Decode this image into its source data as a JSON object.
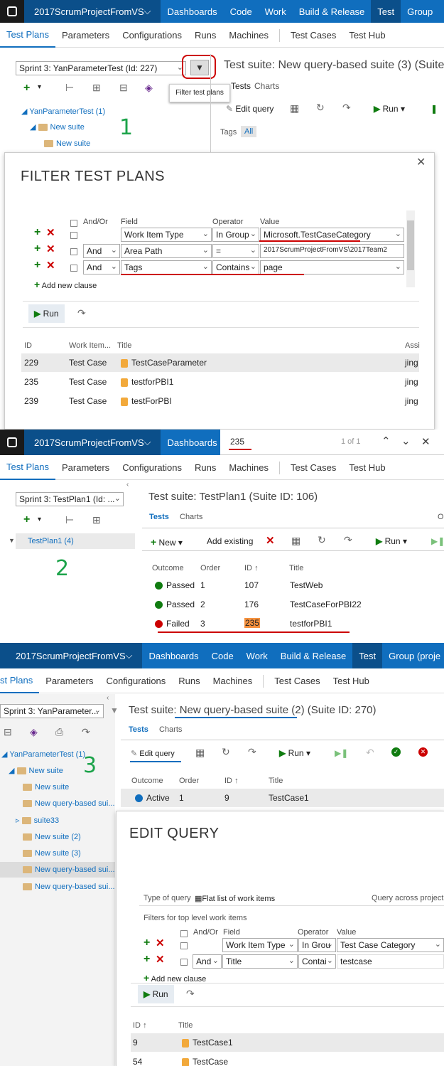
{
  "panel1": {
    "project": "2017ScrumProjectFromVS",
    "nav": [
      "Dashboards",
      "Code",
      "Work",
      "Build & Release",
      "Test",
      "Group"
    ],
    "subnav": [
      "Test Plans",
      "Parameters",
      "Configurations",
      "Runs",
      "Machines",
      "Test Cases",
      "Test Hub"
    ],
    "plan_select": "Sprint 3: YanParameterTest (Id: 227)",
    "suite_title": "Test suite: New query-based suite (3) (Suite I",
    "tooltip": "Filter test plans",
    "tabs": [
      "Tests",
      "Charts"
    ],
    "edit_query": "Edit query",
    "run": "Run",
    "tags_label": "Tags",
    "tags_all": "All",
    "tree": [
      "YanParameterTest (1)",
      "New suite",
      "New suite"
    ],
    "number": "1",
    "dialog_title": "FILTER TEST PLANS",
    "headers": {
      "andor": "And/Or",
      "field": "Field",
      "operator": "Operator",
      "value": "Value"
    },
    "clauses": [
      {
        "andor": "",
        "field": "Work Item Type",
        "op": "In Group",
        "value": "Microsoft.TestCaseCategory"
      },
      {
        "andor": "And",
        "field": "Area Path",
        "op": "=",
        "value": "2017ScrumProjectFromVS\\2017Team2"
      },
      {
        "andor": "And",
        "field": "Tags",
        "op": "Contains",
        "value": "page"
      }
    ],
    "add_clause": "Add new clause",
    "run_btn": "Run",
    "result_headers": {
      "id": "ID",
      "type": "Work Item...",
      "title": "Title",
      "assigned": "Assi"
    },
    "results": [
      {
        "id": "229",
        "type": "Test Case",
        "title": "TestCaseParameter",
        "assigned": "jing"
      },
      {
        "id": "235",
        "type": "Test Case",
        "title": "testforPBI1",
        "assigned": "jing"
      },
      {
        "id": "239",
        "type": "Test Case",
        "title": "testForPBI",
        "assigned": "jing"
      }
    ]
  },
  "panel2": {
    "project": "2017ScrumProjectFromVS",
    "nav_dashboards": "Dashboards",
    "find_value": "235",
    "find_count": "1 of 1",
    "subnav": [
      "Test Plans",
      "Parameters",
      "Configurations",
      "Runs",
      "Machines",
      "Test Cases",
      "Test Hub"
    ],
    "plan_select": "Sprint 3: TestPlan1 (Id: ...",
    "suite_title": "Test suite: TestPlan1 (Suite ID: 106)",
    "tabs": [
      "Tests",
      "Charts"
    ],
    "tab_cut": "O",
    "new": "New",
    "add_existing": "Add existing",
    "run": "Run",
    "tree_item": "TestPlan1 (4)",
    "number": "2",
    "headers": {
      "outcome": "Outcome",
      "order": "Order",
      "id": "ID",
      "title": "Title"
    },
    "rows": [
      {
        "outcome": "Passed",
        "order": "1",
        "id": "107",
        "title": "TestWeb"
      },
      {
        "outcome": "Passed",
        "order": "2",
        "id": "176",
        "title": "TestCaseForPBI22"
      },
      {
        "outcome": "Failed",
        "order": "3",
        "id": "235",
        "title": "testforPBI1"
      }
    ]
  },
  "panel3": {
    "project": "2017ScrumProjectFromVS",
    "nav": [
      "Dashboards",
      "Code",
      "Work",
      "Build & Release",
      "Test",
      "Group (proje"
    ],
    "subnav": [
      "st Plans",
      "Parameters",
      "Configurations",
      "Runs",
      "Machines",
      "Test Cases",
      "Test Hub"
    ],
    "plan_select": "Sprint 3: YanParameter...",
    "suite_title_pre": "Test suite: ",
    "suite_title_link": "New query-based suite (2)",
    "suite_title_post": " (Suite ID: 270)",
    "tabs": [
      "Tests",
      "Charts"
    ],
    "edit_query": "Edit query",
    "run": "Run",
    "number": "3",
    "tree": [
      "YanParameterTest (1)",
      "New suite",
      "New suite",
      "New query-based sui...",
      "suite33",
      "New suite (2)",
      "New suite (3)",
      "New query-based sui...",
      "New query-based sui..."
    ],
    "headers": {
      "outcome": "Outcome",
      "order": "Order",
      "id": "ID",
      "title": "Title"
    },
    "row": {
      "outcome": "Active",
      "order": "1",
      "id": "9",
      "title": "TestCase1"
    },
    "dialog_title": "EDIT QUERY",
    "type_label": "Type of query",
    "type_value": "Flat list of work items",
    "across": "Query across projects",
    "filters_label": "Filters for top level work items",
    "qheaders": {
      "andor": "And/Or",
      "field": "Field",
      "operator": "Operator",
      "value": "Value"
    },
    "clauses": [
      {
        "andor": "",
        "field": "Work Item Type",
        "op": "In Grou",
        "value": "Test Case Category"
      },
      {
        "andor": "And",
        "field": "Title",
        "op": "Contai",
        "value": "testcase"
      }
    ],
    "add_clause": "Add new clause",
    "run_btn": "Run",
    "result_headers": {
      "id": "ID",
      "title": "Title"
    },
    "results": [
      {
        "id": "9",
        "title": "TestCase1"
      },
      {
        "id": "54",
        "title": "TestCase"
      }
    ]
  }
}
